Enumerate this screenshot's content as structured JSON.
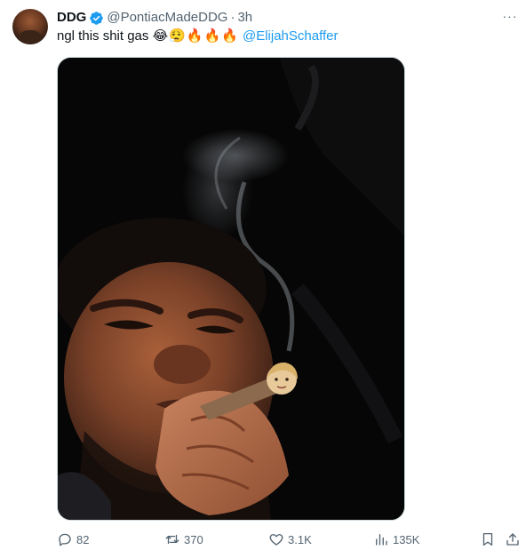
{
  "tweet": {
    "author_name": "DDG",
    "verified": true,
    "handle": "@PontiacMadeDDG",
    "separator": "·",
    "time": "3h",
    "more_label": "···",
    "text": "ngl this shit gas",
    "emojis": "😂😮‍💨🔥🔥🔥",
    "mention": "@ElijahSchaffer",
    "accent_color": "#1d9bf0"
  },
  "actions": {
    "replies": "82",
    "reposts": "370",
    "likes": "3.1K",
    "views": "135K"
  },
  "icons": {
    "verified": "verified-badge-icon",
    "more": "more-dots-icon",
    "reply": "reply-bubble-icon",
    "repost": "repost-arrows-icon",
    "like": "heart-icon",
    "views": "bar-chart-icon",
    "bookmark": "bookmark-icon",
    "share": "share-upload-icon"
  }
}
